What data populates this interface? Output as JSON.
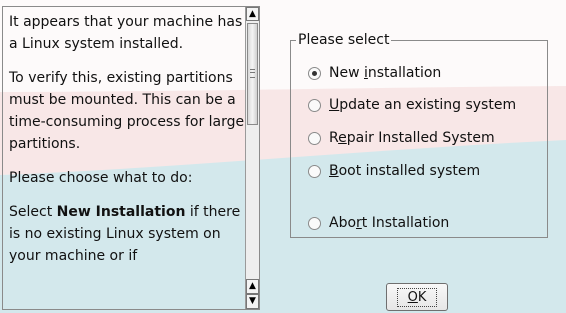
{
  "help": {
    "p1": "It appears that your machine has a Linux system installed.",
    "p2": "To verify this, existing partitions must be mounted. This can be a time-consuming process for large partitions.",
    "p3": "Please choose what to do:",
    "p4_bold": "New Installation",
    "p4_before": "Select ",
    "p4_after": " if there is no existing Linux system on your machine or if"
  },
  "frame": {
    "legend": "Please select"
  },
  "options": [
    {
      "pre": "New ",
      "key": "i",
      "post": "nstallation",
      "checked": true
    },
    {
      "pre": "",
      "key": "U",
      "post": "pdate an existing system",
      "checked": false
    },
    {
      "pre": "R",
      "key": "e",
      "post": "pair Installed System",
      "checked": false
    },
    {
      "pre": "",
      "key": "B",
      "post": "oot installed system",
      "checked": false
    },
    {
      "pre": "Abo",
      "key": "r",
      "post": "t Installation",
      "checked": false
    }
  ],
  "ok": {
    "key": "O",
    "rest": "K"
  },
  "colors": {
    "teal_band": "#cfe6ea",
    "pink_band": "#f6e4e4"
  }
}
